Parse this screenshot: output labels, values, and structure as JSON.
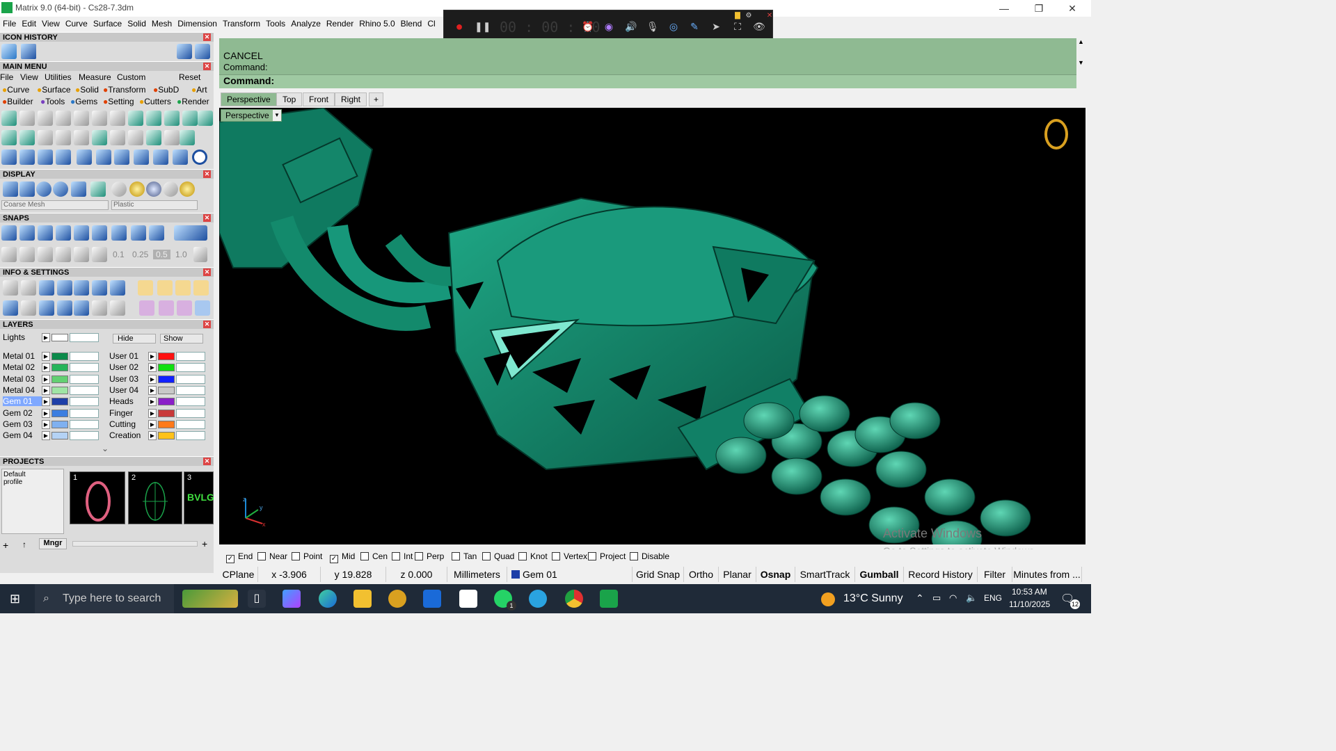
{
  "window": {
    "title": "Matrix 9.0 (64-bit) - Cs28-7.3dm",
    "controls": [
      "—",
      "❐",
      "✕"
    ]
  },
  "menubar": [
    "File",
    "Edit",
    "View",
    "Curve",
    "Surface",
    "Solid",
    "Mesh",
    "Dimension",
    "Transform",
    "Tools",
    "Analyze",
    "Render",
    "Rhino 5.0",
    "Blend",
    "Cl"
  ],
  "recorder": {
    "time": "00 : 00 : 00"
  },
  "panels": {
    "icon_history": "ICON HISTORY",
    "main_menu": "MAIN MENU",
    "display": "DISPLAY",
    "snaps": "SNAPS",
    "info": "INFO & SETTINGS",
    "layers": "LAYERS",
    "projects": "PROJECTS"
  },
  "main_menu": {
    "row1": [
      "File",
      "View",
      "Utilities",
      "Measure",
      "Custom",
      "Reset"
    ],
    "row2": [
      "Curve",
      "Surface",
      "Solid",
      "Transform",
      "SubD",
      "Art"
    ],
    "row3": [
      "Builder",
      "Tools",
      "Gems",
      "Setting",
      "Cutters",
      "Render"
    ]
  },
  "display": {
    "mesh": "Coarse Mesh",
    "material": "Plastic"
  },
  "snaps": {
    "values": [
      "0.1",
      "0.25",
      "0.5",
      "1.0"
    ]
  },
  "layers": {
    "lights": "Lights",
    "hide": "Hide",
    "show": "Show",
    "left": [
      {
        "name": "Metal 01",
        "color": "#0b8a4a"
      },
      {
        "name": "Metal 02",
        "color": "#27b45a"
      },
      {
        "name": "Metal 03",
        "color": "#63d072"
      },
      {
        "name": "Metal 04",
        "color": "#9fe5a5"
      },
      {
        "name": "Gem 01",
        "color": "#1e3fa8",
        "selected": true
      },
      {
        "name": "Gem 02",
        "color": "#3c7ee0"
      },
      {
        "name": "Gem 03",
        "color": "#7fb0f0"
      },
      {
        "name": "Gem 04",
        "color": "#b4d2f5"
      }
    ],
    "right": [
      {
        "name": "User 01",
        "color": "#ff1010"
      },
      {
        "name": "User 02",
        "color": "#10e010"
      },
      {
        "name": "User 03",
        "color": "#1020ff"
      },
      {
        "name": "User 04",
        "color": "#c8c8c8"
      },
      {
        "name": "Heads",
        "color": "#8a1fc8"
      },
      {
        "name": "Finger",
        "color": "#c83a3a"
      },
      {
        "name": "Cutting",
        "color": "#ff7a1a"
      },
      {
        "name": "Creation",
        "color": "#ffc21a"
      }
    ]
  },
  "projects": {
    "profile": "Default\nprofile",
    "items": [
      "1",
      "2",
      "3"
    ],
    "thumb3_text": "BVLG",
    "mngr": "Mngr"
  },
  "command": {
    "line1": "CANCEL",
    "line2": "Command:",
    "prompt": "Command:"
  },
  "viewtabs": [
    "Perspective",
    "Top",
    "Front",
    "Right"
  ],
  "viewport": {
    "label": "Perspective",
    "watermark1": "Activate Windows",
    "watermark2": "Go to Settings to activate Windows."
  },
  "osnaps": [
    {
      "label": "End",
      "checked": true
    },
    {
      "label": "Near",
      "checked": false
    },
    {
      "label": "Point",
      "checked": false
    },
    {
      "label": "Mid",
      "checked": true
    },
    {
      "label": "Cen",
      "checked": false
    },
    {
      "label": "Int",
      "checked": false
    },
    {
      "label": "Perp",
      "checked": false
    },
    {
      "label": "Tan",
      "checked": false
    },
    {
      "label": "Quad",
      "checked": false
    },
    {
      "label": "Knot",
      "checked": false
    },
    {
      "label": "Vertex",
      "checked": false
    },
    {
      "label": "Project",
      "checked": false
    },
    {
      "label": "Disable",
      "checked": false
    }
  ],
  "status": {
    "cplane": "CPlane",
    "x": "x -3.906",
    "y": "y 19.828",
    "z": "z 0.000",
    "units": "Millimeters",
    "layer": "Gem 01",
    "gridsnap": "Grid Snap",
    "ortho": "Ortho",
    "planar": "Planar",
    "osnap": "Osnap",
    "smarttrack": "SmartTrack",
    "gumball": "Gumball",
    "history": "Record History",
    "filter": "Filter",
    "minutes": "Minutes from ..."
  },
  "taskbar": {
    "search": "Type here to search",
    "weather": "13°C  Sunny",
    "lang": "ENG",
    "time": "10:53 AM",
    "date": "11/10/2025",
    "notif": "12",
    "wa_badge": "1"
  }
}
